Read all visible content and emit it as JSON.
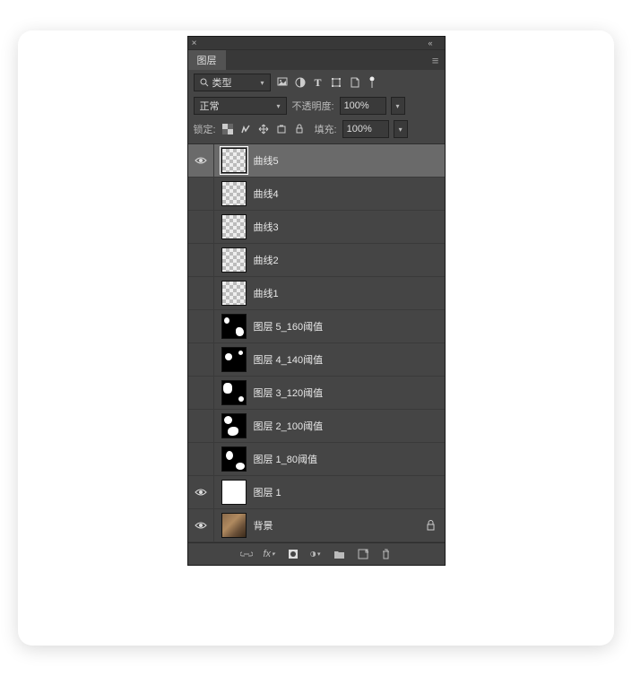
{
  "panel": {
    "title": "图层",
    "filter": {
      "label": "类型"
    },
    "blend": {
      "mode": "正常",
      "opacity_label": "不透明度:",
      "opacity_value": "100%"
    },
    "lock": {
      "label": "锁定:",
      "fill_label": "填充:",
      "fill_value": "100%"
    }
  },
  "layers": [
    {
      "name": "曲线5",
      "visible": true,
      "selected": true,
      "thumb": "checker"
    },
    {
      "name": "曲线4",
      "visible": false,
      "selected": false,
      "thumb": "checker"
    },
    {
      "name": "曲线3",
      "visible": false,
      "selected": false,
      "thumb": "checker"
    },
    {
      "name": "曲线2",
      "visible": false,
      "selected": false,
      "thumb": "checker"
    },
    {
      "name": "曲线1",
      "visible": false,
      "selected": false,
      "thumb": "checker"
    },
    {
      "name": "图层 5_160阈值",
      "visible": false,
      "selected": false,
      "thumb": "t1"
    },
    {
      "name": "图层 4_140阈值",
      "visible": false,
      "selected": false,
      "thumb": "t2"
    },
    {
      "name": "图层 3_120阈值",
      "visible": false,
      "selected": false,
      "thumb": "t3"
    },
    {
      "name": "图层 2_100阈值",
      "visible": false,
      "selected": false,
      "thumb": "t4"
    },
    {
      "name": "图层 1_80阈值",
      "visible": false,
      "selected": false,
      "thumb": "t5"
    },
    {
      "name": "图层 1",
      "visible": true,
      "selected": false,
      "thumb": "white"
    },
    {
      "name": "背景",
      "visible": true,
      "selected": false,
      "thumb": "photo",
      "locked": true
    }
  ]
}
